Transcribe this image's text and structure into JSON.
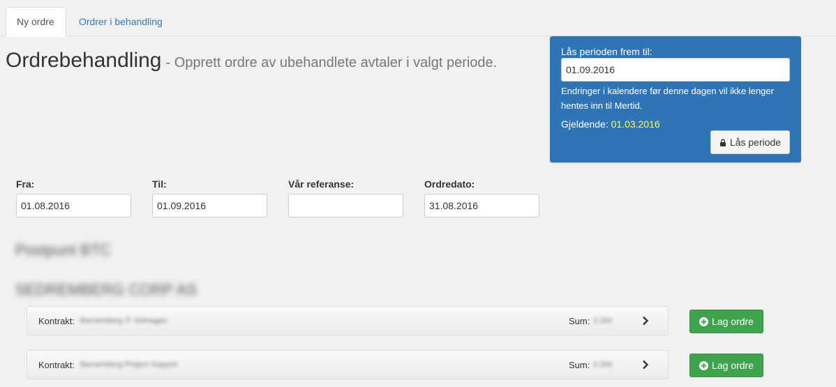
{
  "tabs": [
    {
      "label": "Ny ordre"
    },
    {
      "label": "Ordrer i behandling"
    }
  ],
  "header": {
    "title": "Ordrebehandling",
    "subtitle": "- Opprett ordre av ubehandlete avtaler i valgt periode."
  },
  "lock_panel": {
    "label": "Lås perioden frem til:",
    "date_value": "01.09.2016",
    "info": "Endringer i kalendere før denne dagen vil ikke lenger hentes inn til Mertid.",
    "current_label": "Gjeldende:",
    "current_date": "01.03.2016",
    "button_label": "Lås periode",
    "accent_color": "#2f75b5"
  },
  "filters": {
    "from": {
      "label": "Fra:",
      "value": "01.08.2016"
    },
    "to": {
      "label": "Til:",
      "value": "01.09.2016"
    },
    "reference": {
      "label": "Vår referanse:",
      "value": ""
    },
    "order_date": {
      "label": "Ordredato:",
      "value": "31.08.2016"
    }
  },
  "blurred": {
    "heading1": "Postpunt BTC",
    "heading2": "SEDREMBERG CORP AS"
  },
  "contracts": [
    {
      "label": "Kontrakt:",
      "name": "Barnemberg IT Velmagen",
      "sum_label": "Sum:",
      "sum_value": "3 200",
      "button_label": "Lag ordre"
    },
    {
      "label": "Kontrakt:",
      "name": "Barnemberg Project Support",
      "sum_label": "Sum:",
      "sum_value": "3 200",
      "button_label": "Lag ordre"
    }
  ],
  "icons": {
    "lock": "lock-icon",
    "chevron": "chevron-right-icon",
    "plus": "plus-circle-icon"
  }
}
